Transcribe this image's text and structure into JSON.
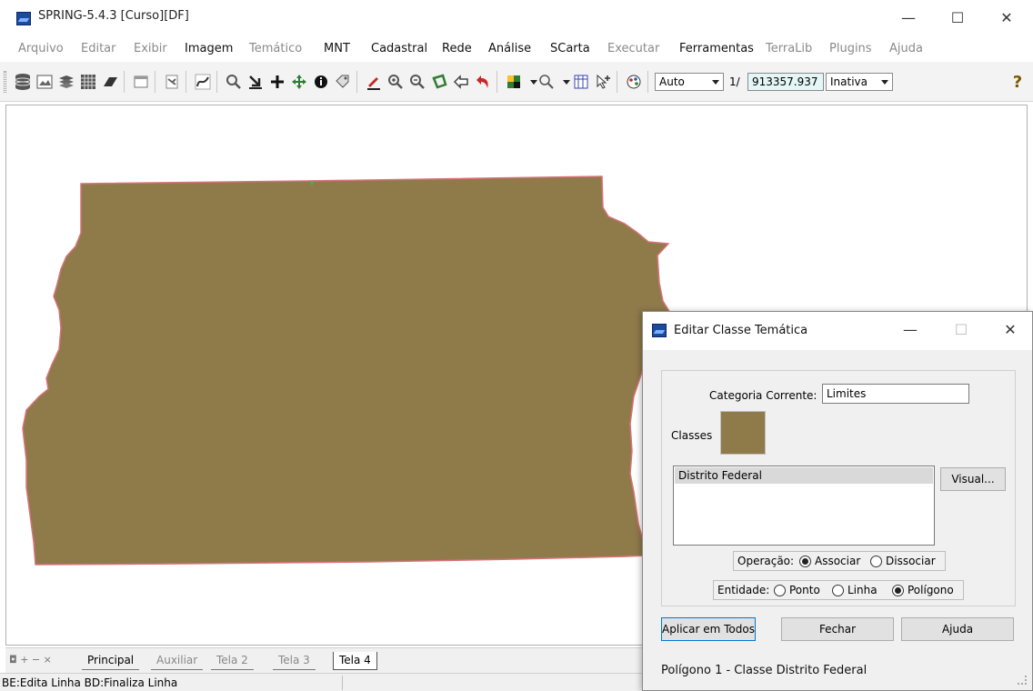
{
  "window": {
    "title": "SPRING-5.4.3 [Curso][DF]",
    "minimize_glyph": "—",
    "maximize_glyph": "☐",
    "close_glyph": "✕"
  },
  "menu": [
    {
      "label": "Arquivo",
      "enabled": false
    },
    {
      "label": "Editar",
      "enabled": false
    },
    {
      "label": "Exibir",
      "enabled": false
    },
    {
      "label": "Imagem",
      "enabled": true
    },
    {
      "label": "Temático",
      "enabled": false
    },
    {
      "label": "MNT",
      "enabled": true
    },
    {
      "label": "Cadastral",
      "enabled": true
    },
    {
      "label": "Rede",
      "enabled": true
    },
    {
      "label": "Análise",
      "enabled": true
    },
    {
      "label": "SCarta",
      "enabled": true
    },
    {
      "label": "Executar",
      "enabled": false
    },
    {
      "label": "Ferramentas",
      "enabled": true
    },
    {
      "label": "TerraLib",
      "enabled": false
    },
    {
      "label": "Plugins",
      "enabled": false
    },
    {
      "label": "Ajuda",
      "enabled": false
    }
  ],
  "toolbar": {
    "icons": [
      "database-icon",
      "image-icon",
      "layers-icon",
      "grid-icon",
      "eraser-icon",
      "window-icon",
      "tool-icon",
      "curve-icon",
      "search-icon",
      "arrow-down-icon",
      "crosshair-icon",
      "pan-icon",
      "info-icon",
      "tag-icon",
      "pencil-icon",
      "zoom-in-icon",
      "zoom-out-icon",
      "lasso-icon",
      "back-icon",
      "undo-icon",
      "palette-icon-1",
      "zoom-area-icon",
      "table-icon",
      "cursor-plus-icon",
      "colors-icon"
    ],
    "scale_mode": "Auto",
    "scale_prefix": "1/",
    "scale_value": "913357.937",
    "state": "Inativa",
    "help_glyph": "?"
  },
  "map": {
    "fill_color": "#8F7A4A",
    "border_color": "#d9727a"
  },
  "tabs": {
    "nav": "◘ + − ×",
    "items": [
      {
        "label": "Principal",
        "active": false
      },
      {
        "label": "Auxiliar",
        "active": false
      },
      {
        "label": "Tela 2",
        "active": false
      },
      {
        "label": "Tela 3",
        "active": false
      },
      {
        "label": "Tela 4",
        "active": true
      }
    ]
  },
  "status": {
    "text": "BE:Edita Linha  BD:Finaliza Linha"
  },
  "dialog": {
    "title": "Editar Classe Temática",
    "minimize_glyph": "—",
    "maximize_glyph": "☐",
    "close_glyph": "✕",
    "category_label": "Categoria Corrente:",
    "category_value": "Limites",
    "classes_label": "Classes",
    "class_color": "#8F7A4A",
    "classes": [
      "Distrito Federal"
    ],
    "visual_button": "Visual...",
    "operation_label": "Operação:",
    "operation_options": [
      "Associar",
      "Dissociar"
    ],
    "operation_selected": "Associar",
    "entity_label": "Entidade:",
    "entity_options": [
      "Ponto",
      "Linha",
      "Polígono"
    ],
    "entity_selected": "Polígono",
    "apply_all_button": "Aplicar em Todos",
    "close_button": "Fechar",
    "help_button": "Ajuda",
    "status": "Polígono 1 - Classe Distrito Federal"
  }
}
